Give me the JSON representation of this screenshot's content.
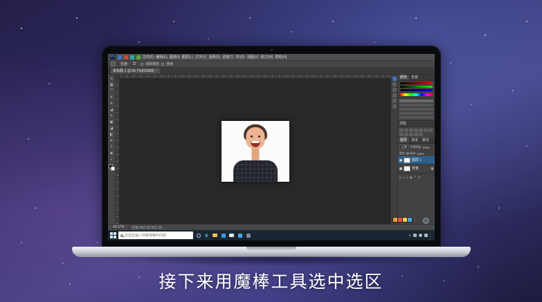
{
  "caption": "接下来用魔棒工具选中选区",
  "photoshop": {
    "app_label": "Ps",
    "menu": [
      "文件(F)",
      "编辑(E)",
      "图像(I)",
      "图层(L)",
      "文字(Y)",
      "选择(S)",
      "滤镜(T)",
      "3D(D)",
      "视图(V)",
      "窗口(W)",
      "帮助(H)"
    ],
    "options": {
      "tolerance_label": "容差:",
      "tolerance_value": "32",
      "anti_alias_label": "消除锯齿",
      "contiguous_label": "连续"
    },
    "doc_tab": "未标题-1 @ 66.7%(RGB/8)",
    "tab_close_glyph": "×",
    "tools": [
      {
        "name": "move",
        "glyph": "✛"
      },
      {
        "name": "marquee",
        "glyph": "▦"
      },
      {
        "name": "lasso",
        "glyph": "⌒"
      },
      {
        "name": "magic-wand",
        "glyph": "✶"
      },
      {
        "name": "crop",
        "glyph": "⌗"
      },
      {
        "name": "eyedropper",
        "glyph": "◢"
      },
      {
        "name": "brush",
        "glyph": "✎"
      },
      {
        "name": "stamp",
        "glyph": "▣"
      },
      {
        "name": "eraser",
        "glyph": "◪"
      },
      {
        "name": "gradient",
        "glyph": "◧"
      },
      {
        "name": "pen",
        "glyph": "✒"
      },
      {
        "name": "type",
        "glyph": "T"
      },
      {
        "name": "hand",
        "glyph": "◉"
      },
      {
        "name": "zoom",
        "glyph": "⌕"
      }
    ],
    "panels": {
      "color_tabs": [
        "颜色",
        "色板"
      ],
      "adjustments_title": "调整",
      "layers_tabs": [
        "图层",
        "通道",
        "路径"
      ],
      "blend_mode": "正常",
      "opacity_label": "不透明度:",
      "opacity_value": "100%",
      "lock_label": "锁定:",
      "fill_label": "填充:",
      "fill_value": "100%",
      "layers": [
        {
          "name": "图层 1"
        },
        {
          "name": "背景"
        }
      ],
      "footer_glyphs": [
        "fx",
        "◻",
        "●",
        "▣",
        "＋",
        "▼"
      ]
    },
    "status": {
      "zoom": "66.67%",
      "doc_info": "文档:452.2K/452.2K"
    }
  },
  "taskbar": {
    "search_placeholder": "在这里输入你要搜索的内容",
    "edge_glyph": "e",
    "tray_caret": "∧"
  },
  "colors": {
    "selection_blue": "#2d5f8a",
    "taskbar_bg": "#1b2531",
    "accent_blue": "#2f7fd6",
    "capture_chips": [
      "#f29a38",
      "#e25446",
      "#f5d04c",
      "#4aa0dc"
    ]
  }
}
